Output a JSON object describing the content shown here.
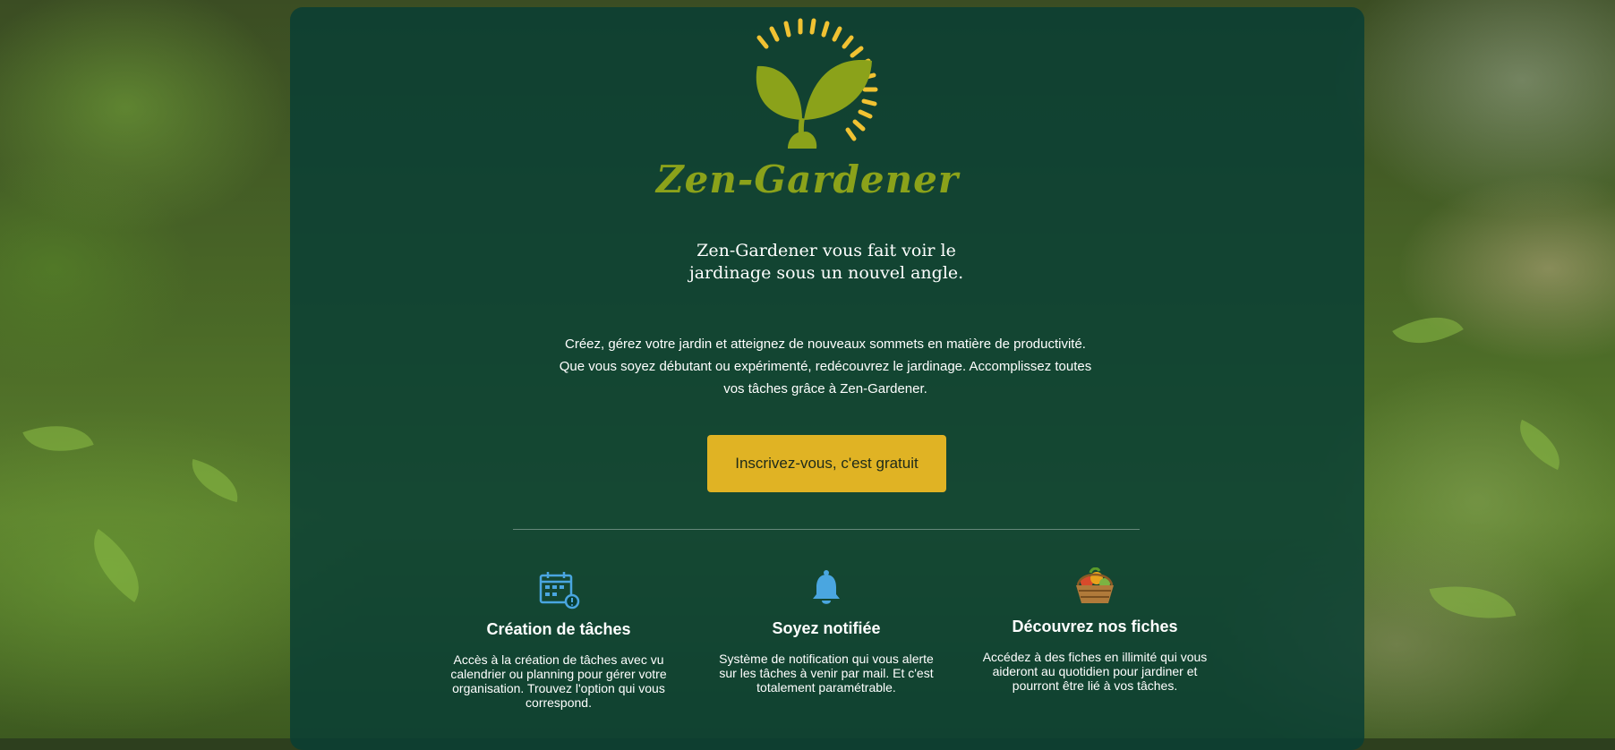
{
  "brand": {
    "name": "Zen-Gardener",
    "logo_icon": "sprout-sun-logo-icon",
    "colors": {
      "leaf": "#8ba21a",
      "sun": "#f1c232",
      "panel": "#083e34",
      "cta": "#e0b324"
    }
  },
  "hero": {
    "tagline": "Zen-Gardener vous fait voir le jardinage sous un nouvel angle.",
    "intro_line1": "Créez, gérez votre jardin et atteignez de nouveaux sommets en matière de productivité.",
    "intro_line2": "Que vous soyez débutant ou expérimenté, redécouvrez le jardinage. Accomplissez toutes",
    "intro_line3": "vos tâches grâce à Zen-Gardener.",
    "cta_label": "Inscrivez-vous, c'est gratuit"
  },
  "features": [
    {
      "icon": "calendar-alert-icon",
      "title": "Création de tâches",
      "text": "Accès à la création de tâches avec vu calendrier ou planning pour gérer votre organisation. Trouvez l'option qui vous correspond."
    },
    {
      "icon": "bell-icon",
      "title": "Soyez notifiée",
      "text": "Système de notification qui vous alerte sur les tâches à venir par mail. Et c'est totalement paramétrable."
    },
    {
      "icon": "vegetable-basket-icon",
      "title": "Découvrez nos fiches",
      "text": "Accédez à des fiches en illimité qui vous aideront au quotidien pour jardiner et pourront être lié à vos tâches."
    }
  ]
}
